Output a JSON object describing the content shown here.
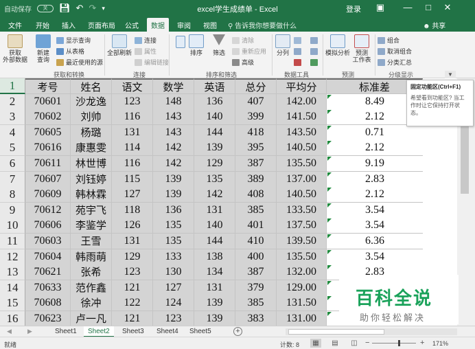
{
  "window": {
    "autosave_label": "自动保存",
    "autosave_state": "关",
    "title": "excel学生成绩单 - Excel",
    "login": "登录"
  },
  "tabs": [
    "文件",
    "开始",
    "插入",
    "页面布局",
    "公式",
    "数据",
    "审阅",
    "视图"
  ],
  "active_tab": "数据",
  "tellme": "告诉我你想要做什么",
  "share": "共享",
  "ribbon": {
    "get_data": "获取\n外部数据",
    "new_query": "新建\n查询",
    "show_queries": "显示查询",
    "from_table": "从表格",
    "recent_sources": "最近使用的源",
    "group_transform": "获取和转换",
    "refresh_all": "全部刷新",
    "connections": "连接",
    "properties": "属性",
    "edit_links": "编辑链接",
    "group_connections": "连接",
    "sort": "排序",
    "filter": "筛选",
    "clear": "清除",
    "reapply": "重新应用",
    "advanced": "高级",
    "group_sort_filter": "排序和筛选",
    "text_to_columns": "分列",
    "group_data_tools": "数据工具",
    "what_if": "模拟分析",
    "forecast_sheet": "预测\n工作表",
    "group_forecast": "预测",
    "group_item": "组合",
    "ungroup": "取消组合",
    "subtotal": "分类汇总",
    "group_outline": "分级显示"
  },
  "tooltip": {
    "title": "固定功能区(Ctrl+F1)",
    "body": "希望看到功能区? 当工作时让它保持打开状态。"
  },
  "sheet": {
    "row_numbers": [
      "1",
      "2",
      "3",
      "4",
      "5",
      "6",
      "7",
      "8",
      "9",
      "10",
      "11",
      "12",
      "13",
      "14",
      "15",
      "16"
    ],
    "headers": [
      "考号",
      "姓名",
      "语文",
      "数学",
      "英语",
      "总分",
      "平均分",
      "标准差"
    ],
    "rows": [
      [
        "70601",
        "沙龙逸",
        "123",
        "148",
        "136",
        "407",
        "142.00",
        "8.49"
      ],
      [
        "70602",
        "刘帅",
        "116",
        "143",
        "140",
        "399",
        "141.50",
        "2.12"
      ],
      [
        "70605",
        "杨璐",
        "131",
        "143",
        "144",
        "418",
        "143.50",
        "0.71"
      ],
      [
        "70616",
        "康惠雯",
        "114",
        "142",
        "139",
        "395",
        "140.50",
        "2.12"
      ],
      [
        "70611",
        "林世博",
        "116",
        "142",
        "129",
        "387",
        "135.50",
        "9.19"
      ],
      [
        "70607",
        "刘钰婷",
        "115",
        "139",
        "135",
        "389",
        "137.00",
        "2.83"
      ],
      [
        "70609",
        "韩林霖",
        "127",
        "139",
        "142",
        "408",
        "140.50",
        "2.12"
      ],
      [
        "70612",
        "苑宇飞",
        "118",
        "136",
        "131",
        "385",
        "133.50",
        "3.54"
      ],
      [
        "70606",
        "李鉴学",
        "126",
        "135",
        "140",
        "401",
        "137.50",
        "3.54"
      ],
      [
        "70603",
        "王雪",
        "131",
        "135",
        "144",
        "410",
        "139.50",
        "6.36"
      ],
      [
        "70604",
        "韩雨萌",
        "129",
        "133",
        "138",
        "400",
        "135.50",
        "3.54"
      ],
      [
        "70621",
        "张希",
        "123",
        "130",
        "134",
        "387",
        "132.00",
        "2.83"
      ],
      [
        "70633",
        "范作鑫",
        "121",
        "127",
        "131",
        "379",
        "129.00",
        ""
      ],
      [
        "70608",
        "徐冲",
        "122",
        "124",
        "139",
        "385",
        "131.50",
        ""
      ],
      [
        "70623",
        "卢一凡",
        "121",
        "123",
        "139",
        "383",
        "131.00",
        ""
      ]
    ]
  },
  "sheet_tabs": [
    "Sheet1",
    "Sheet2",
    "Sheet3",
    "Sheet4",
    "Sheet5"
  ],
  "active_sheet": "Sheet2",
  "status": {
    "ready": "就绪",
    "count": "计数: 8",
    "zoom": "171%"
  },
  "watermark": {
    "line1": "百科全说",
    "line2": "助你轻松解决"
  },
  "colors": {
    "excel_green": "#217346",
    "selection_gray": "#d4d4d4",
    "watermark_green": "#1aa25a"
  }
}
